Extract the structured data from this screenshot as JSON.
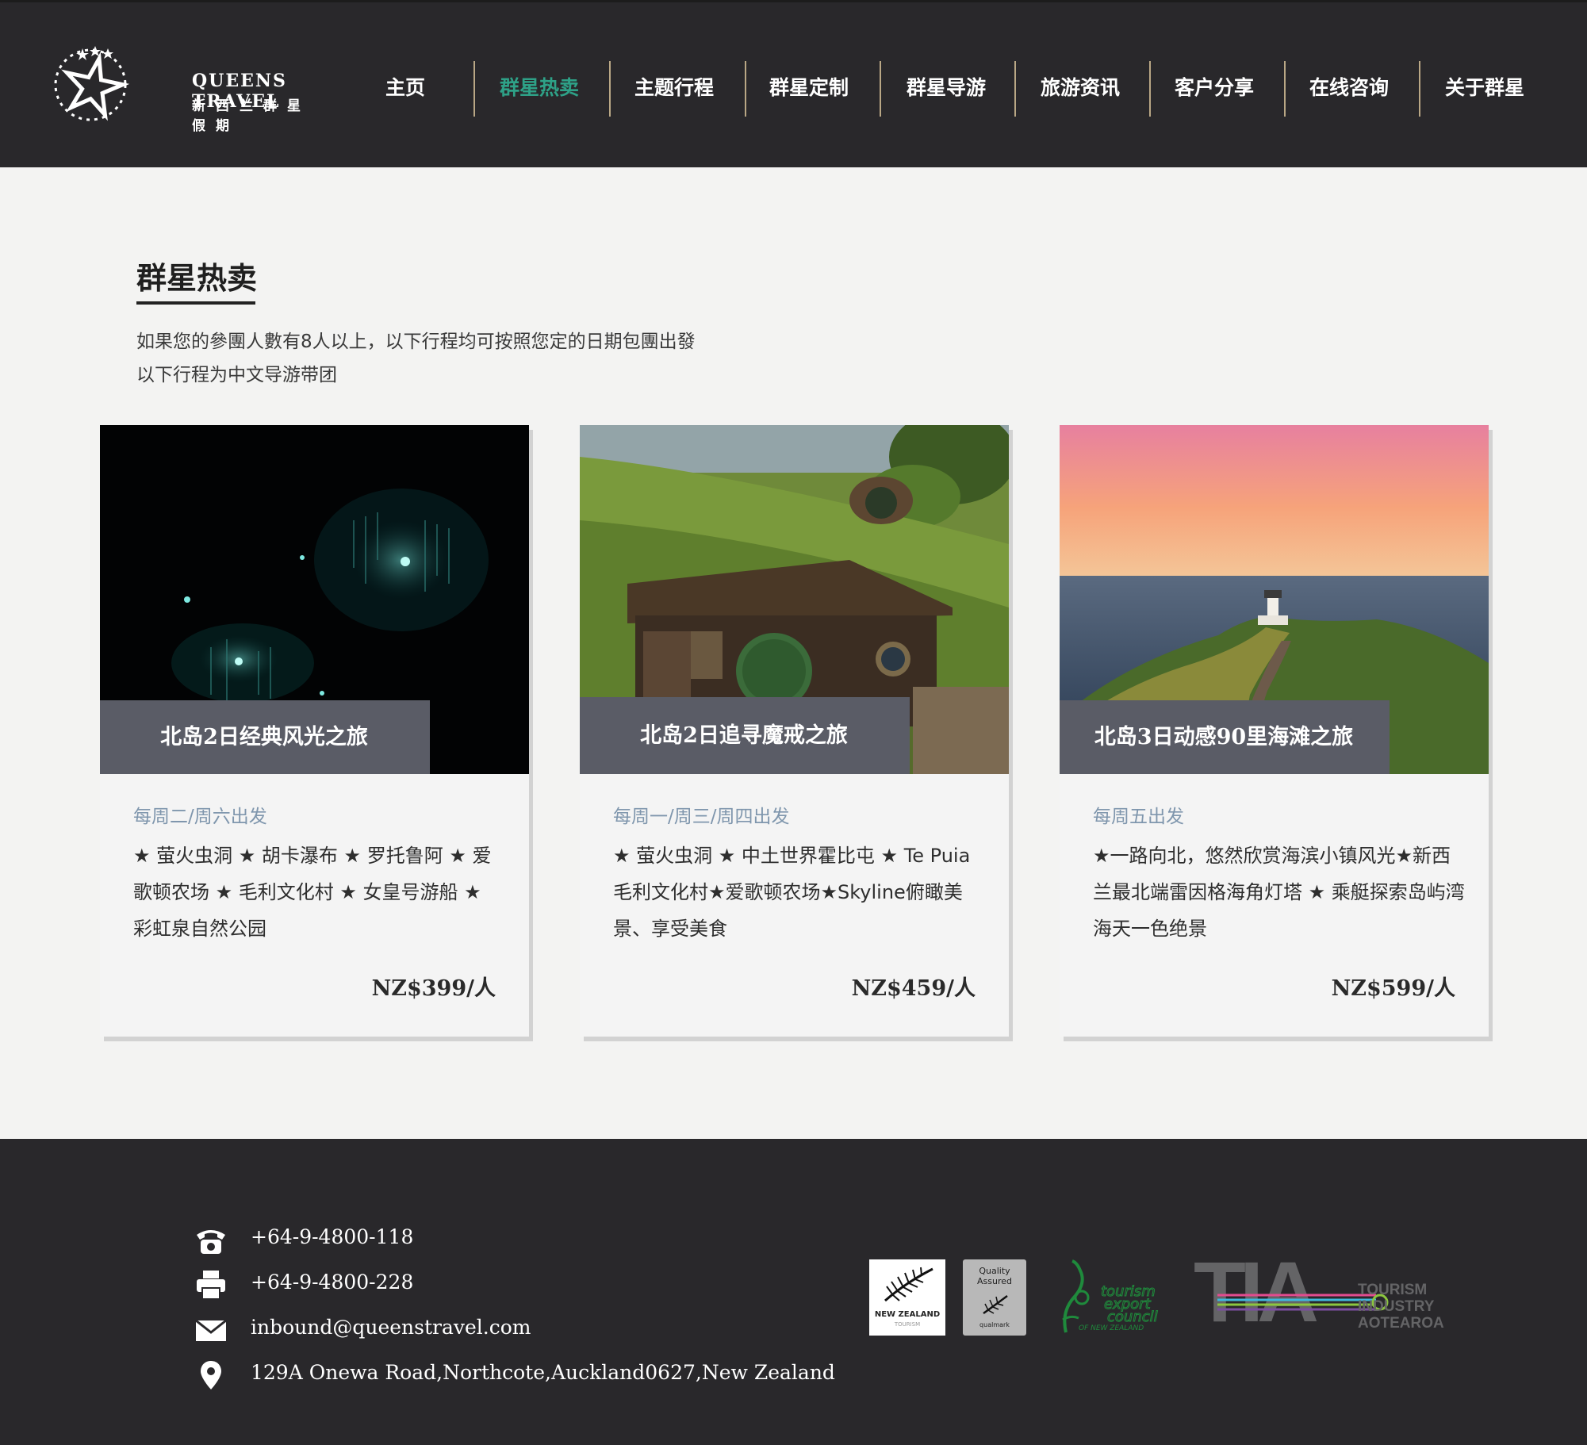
{
  "brand": {
    "name_en": "QUEENS TRAVEL",
    "name_cn": "新西兰群星假期"
  },
  "nav": {
    "items": [
      {
        "label": "主页"
      },
      {
        "label": "群星热卖",
        "active": true
      },
      {
        "label": "主题行程"
      },
      {
        "label": "群星定制"
      },
      {
        "label": "群星导游"
      },
      {
        "label": "旅游资讯"
      },
      {
        "label": "客户分享"
      },
      {
        "label": "在线咨询"
      },
      {
        "label": "关于群星"
      }
    ],
    "active_color": "#2ea187"
  },
  "section": {
    "title": "群星热卖",
    "intro_line1": "如果您的參團人數有8人以上，以下行程均可按照您定的日期包團出發",
    "intro_line2": "以下行程为中文导游带团"
  },
  "cards": [
    {
      "image": "glowworm-cave",
      "title": "北岛2日经典风光之旅",
      "depart": "每周二/周六出发",
      "desc": "★ 萤火虫洞 ★ 胡卡瀑布 ★ 罗托鲁阿 ★ 爱歌顿农场 ★ 毛利文化村 ★ 女皇号游船 ★ 彩虹泉自然公园",
      "price": "NZ$399/人"
    },
    {
      "image": "hobbiton-house",
      "title": "北岛2日追寻魔戒之旅",
      "depart": "每周一/周三/周四出发",
      "desc": "★ 萤火虫洞 ★ 中土世界霍比屯 ★ Te Puia 毛利文化村★爱歌顿农场★Skyline俯瞰美景、享受美食",
      "price": "NZ$459/人"
    },
    {
      "image": "cape-reinga-lighthouse",
      "title": "北岛3日动感90里海滩之旅",
      "depart": "每周五出发",
      "desc": "★一路向北，悠然欣赏海滨小镇风光★新西兰最北端雷因格海角灯塔 ★ 乘艇探索岛屿湾海天一色绝景",
      "price": "NZ$599/人"
    }
  ],
  "footer": {
    "contacts": [
      {
        "icon": "phone-icon",
        "text": "+64-9-4800-118"
      },
      {
        "icon": "fax-icon",
        "text": "+64-9-4800-228"
      },
      {
        "icon": "mail-icon",
        "text": "inbound@queenstravel.com"
      },
      {
        "icon": "location-pin-icon",
        "text": "129A Onewa Road,Northcote,Auckland0627,New Zealand"
      }
    ],
    "badges": {
      "nz": "NEW ZEALAND",
      "nz_sub": "TOURISM",
      "qa_line1": "Quality",
      "qa_line2": "Assured",
      "qa_sub": "qualmark",
      "tec_line1": "tourism",
      "tec_line2": "export",
      "tec_line3": "council",
      "tec_line4": "OF NEW ZEALAND",
      "tia_mark": "TIA",
      "tia_line1": "TOURISM",
      "tia_line2": "INDUSTRY",
      "tia_line3": "AOTEAROA"
    }
  }
}
